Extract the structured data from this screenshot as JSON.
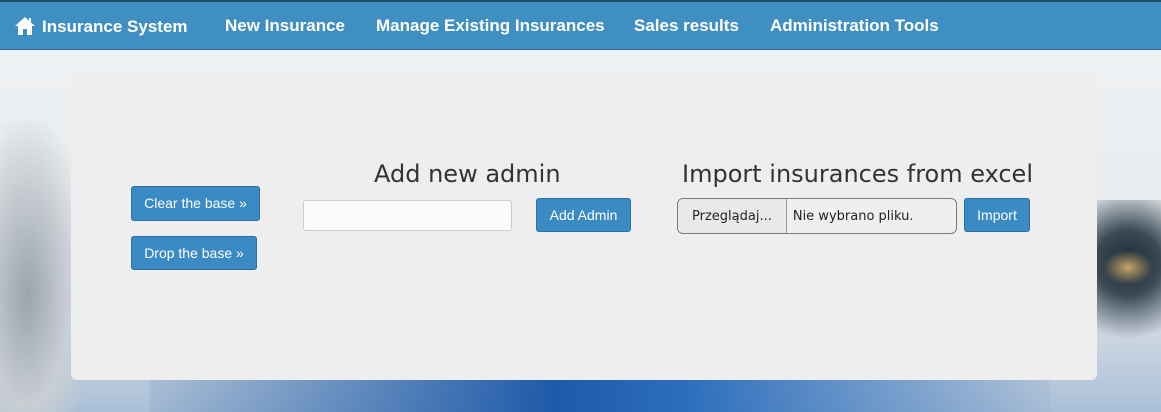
{
  "navbar": {
    "brand": "Insurance System",
    "brand_icon": "home-icon",
    "items": [
      {
        "label": "New Insurance"
      },
      {
        "label": "Manage Existing Insurances"
      },
      {
        "label": "Sales results"
      },
      {
        "label": "Administration Tools"
      }
    ]
  },
  "base_actions": {
    "clear_label": "Clear the base »",
    "drop_label": "Drop the base »"
  },
  "add_admin": {
    "title": "Add new admin",
    "input_value": "",
    "button_label": "Add Admin"
  },
  "import_excel": {
    "title": "Import insurances from excel",
    "browse_label": "Przeglądaj...",
    "file_status": "Nie wybrano pliku.",
    "button_label": "Import"
  },
  "colors": {
    "navbar": "#3f8fc3",
    "button": "#3a8ac4",
    "panel": "#eeeeee"
  }
}
